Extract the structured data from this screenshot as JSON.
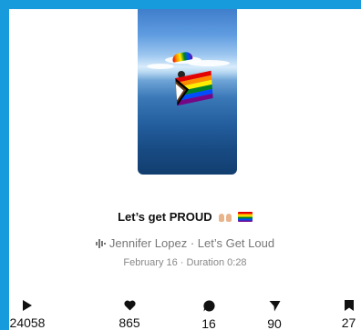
{
  "post": {
    "title": "Let’s get PROUD",
    "title_emojis": [
      "hands-raised-emoji",
      "rainbow-flag-emoji"
    ],
    "audio": "Jennifer Lopez · Let’s Get Loud",
    "date_duration": "February 16 · Duration 0:28"
  },
  "stats": {
    "plays": "24058",
    "likes": "865",
    "comments": "16",
    "shares": "90",
    "saves": "27"
  },
  "icons": {
    "plays": "play-icon",
    "likes": "heart-icon",
    "comments": "comment-icon",
    "shares": "share-icon",
    "saves": "bookmark-icon",
    "audio": "audio-wave-icon"
  },
  "colors": {
    "frame": "#179bdc",
    "card": "#ffffff",
    "text_primary": "#111111",
    "text_secondary": "#777777"
  }
}
